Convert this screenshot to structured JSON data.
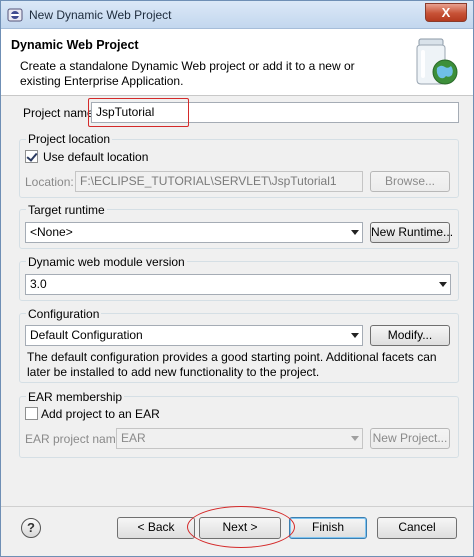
{
  "window": {
    "title": "New Dynamic Web Project",
    "close_label": "X"
  },
  "header": {
    "title": "Dynamic Web Project",
    "description": "Create a standalone Dynamic Web project or add it to a new or existing Enterprise Application."
  },
  "project_name": {
    "label": "Project name:",
    "value": "JspTutorial"
  },
  "project_location": {
    "group_label": "Project location",
    "use_default_label": "Use default location",
    "use_default_checked": true,
    "location_label": "Location:",
    "location_value": "F:\\ECLIPSE_TUTORIAL\\SERVLET\\JspTutorial1",
    "browse_label": "Browse..."
  },
  "target_runtime": {
    "label": "Target runtime",
    "selected": "<None>",
    "new_runtime_label": "New Runtime..."
  },
  "module_version": {
    "label": "Dynamic web module version",
    "selected": "3.0"
  },
  "configuration": {
    "label": "Configuration",
    "selected": "Default Configuration",
    "modify_label": "Modify...",
    "description": "The default configuration provides a good starting point. Additional facets can later be installed to add new functionality to the project."
  },
  "ear_membership": {
    "group_label": "EAR membership",
    "add_to_ear_label": "Add project to an EAR",
    "add_to_ear_checked": false,
    "ear_project_label": "EAR project name:",
    "ear_project_value": "EAR",
    "new_project_label": "New Project..."
  },
  "footer": {
    "help_label": "?",
    "back_label": "< Back",
    "next_label": "Next >",
    "finish_label": "Finish",
    "cancel_label": "Cancel"
  },
  "colors": {
    "annotation_red": "#d42a2a",
    "dialog_bg": "#f0f0f0"
  }
}
